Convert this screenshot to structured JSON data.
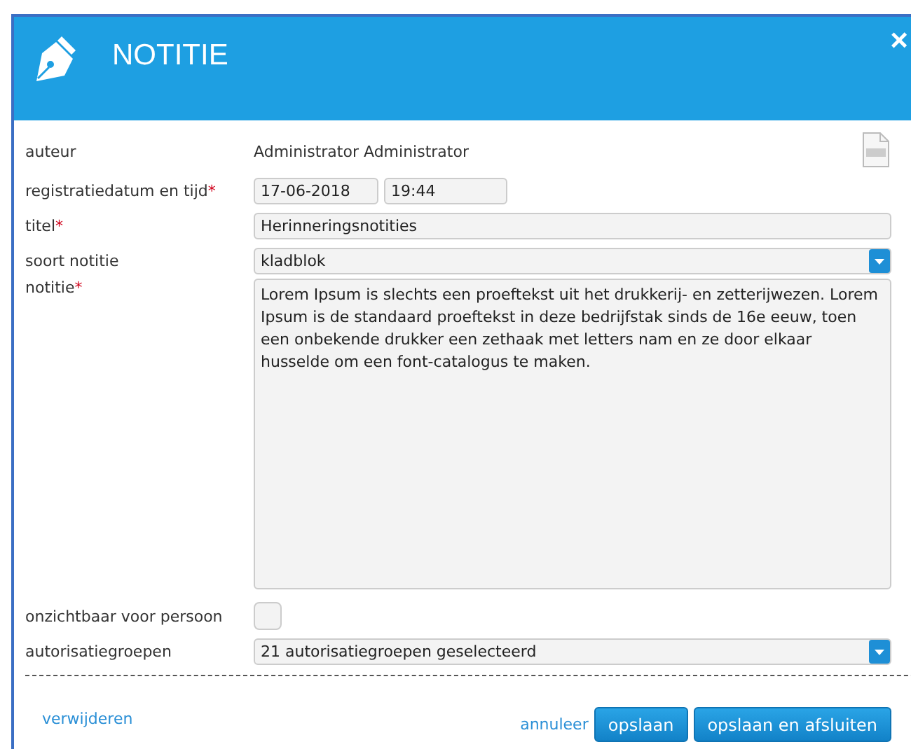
{
  "dialog": {
    "title": "NOTITIE",
    "close": "×"
  },
  "fields": [
    {
      "kind": "text",
      "label": "auteur",
      "value": "Administrator Administrator"
    },
    {
      "kind": "datetime",
      "label": "registratiedatum en tijd",
      "required_mark": "*",
      "date": "17-06-2018",
      "time": "19:44"
    },
    {
      "kind": "input",
      "label": "titel",
      "required_mark": "*",
      "value": "Herinneringsnotities"
    },
    {
      "kind": "select",
      "label": "soort notitie",
      "value": "kladblok"
    },
    {
      "kind": "textarea",
      "label": "notitie",
      "required_mark": "*",
      "value": "Lorem Ipsum is slechts een proeftekst uit het drukkerij- en zetterijwezen. Lorem Ipsum is de standaard proeftekst in deze bedrijfstak sinds de 16e eeuw, toen een onbekende drukker een zethaak met letters nam en ze door elkaar husselde om een font-catalogus te maken."
    },
    {
      "kind": "checkbox",
      "label": "onzichtbaar voor persoon",
      "checked": false
    },
    {
      "kind": "select",
      "label": "autorisatiegroepen",
      "value": "21 autorisatiegroepen geselecteerd"
    }
  ],
  "footer": {
    "delete_link": "verwijderen",
    "cancel_link": "annuleer",
    "buttons": [
      "opslaan",
      "opslaan en afsluiten"
    ]
  }
}
